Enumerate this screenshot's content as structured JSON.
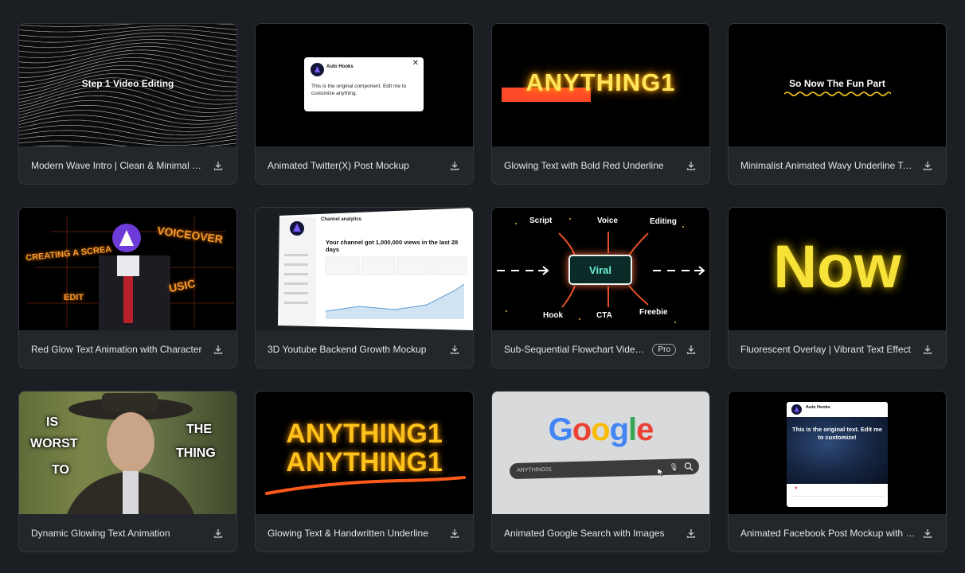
{
  "cards": [
    {
      "title": "Modern Wave Intro | Clean & Minimal Titles",
      "thumb_text": "Step 1 Video Editing"
    },
    {
      "title": "Animated Twitter(X) Post Mockup",
      "thumb_name": "Auto Hooks",
      "thumb_text": "This is the original component. Edit me to customize anything."
    },
    {
      "title": "Glowing Text with Bold Red Underline",
      "thumb_text": "ANYTHING1"
    },
    {
      "title": "Minimalist Animated Wavy Underline Text Effect",
      "thumb_text": "So Now The Fun Part"
    },
    {
      "title": "Red Glow Text Animation with Character",
      "thumb_words": [
        "VOICEOVER",
        "CREATING A SCREA",
        "EDIT",
        "USIC"
      ]
    },
    {
      "title": "3D Youtube Backend Growth Mockup",
      "thumb_heading": "Channel analytics",
      "thumb_text": "Your channel got 1,000,000 views in the last 28 days"
    },
    {
      "title": "Sub-Sequential Flowchart Video | Educational Explainer",
      "badge": "Pro",
      "thumb_words": [
        "Script",
        "Voice",
        "Editing",
        "Viral",
        "Hook",
        "CTA",
        "Freebie"
      ]
    },
    {
      "title": "Fluorescent Overlay | Vibrant Text Effect",
      "thumb_text": "Now"
    },
    {
      "title": "Dynamic Glowing Text Animation",
      "thumb_words": [
        "IS",
        "WORST",
        "TO",
        "THE",
        "THING"
      ]
    },
    {
      "title": "Glowing Text & Handwritten Underline",
      "thumb_lines": [
        "ANYTHING1",
        "ANYTHING1"
      ]
    },
    {
      "title": "Animated Google Search with Images",
      "thumb_brand": "Google",
      "thumb_query": "ANYTHING01"
    },
    {
      "title": "Animated Facebook Post Mockup with Image",
      "thumb_name": "Auto Hooks",
      "thumb_text": "This is the original text. Edit me to customize!"
    }
  ],
  "icons": {
    "download": "download-icon"
  },
  "colors": {
    "background": "#1b1e22",
    "card": "#23262b",
    "border": "#33373d"
  }
}
